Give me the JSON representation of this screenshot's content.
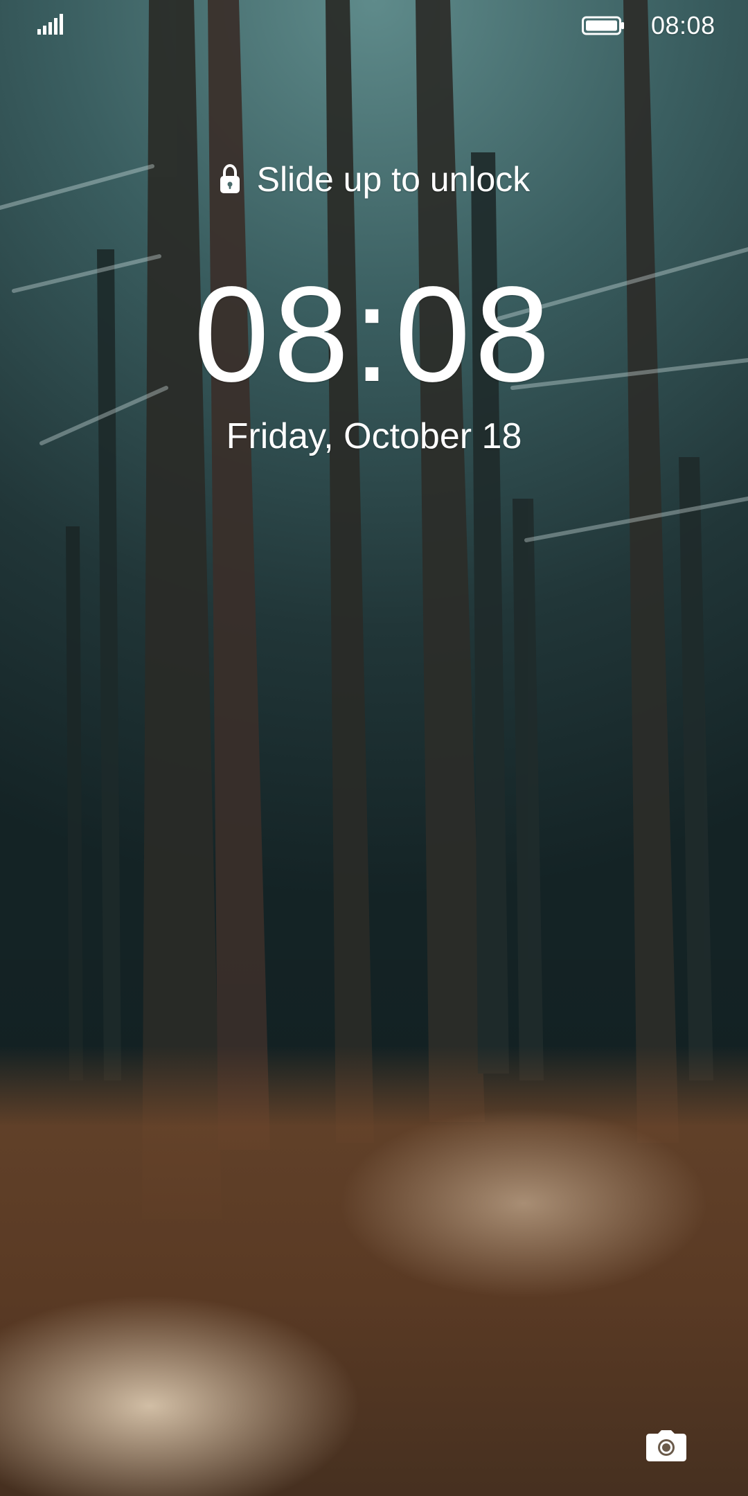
{
  "status_bar": {
    "time": "08:08",
    "signal_icon": "signal-icon",
    "battery_icon": "battery-icon"
  },
  "lockscreen": {
    "unlock_hint": "Slide up to unlock",
    "clock": "08:08",
    "date": "Friday, October 18",
    "lock_icon": "lock-icon",
    "camera_icon": "camera-icon"
  },
  "colors": {
    "text": "#ffffff"
  }
}
